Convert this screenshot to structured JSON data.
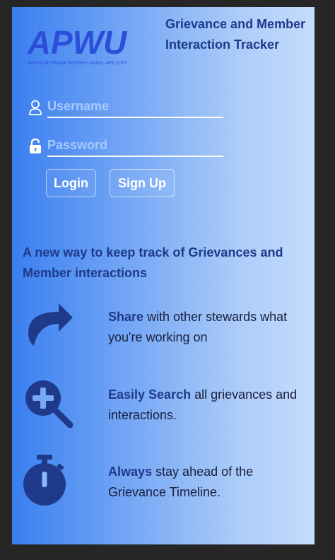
{
  "header": {
    "logo_text": "APWU",
    "logo_subtext": "American Postal Workers Union, AFL-CIO",
    "title": "Grievance and Member Interaction Tracker"
  },
  "login_form": {
    "username_placeholder": "Username",
    "password_placeholder": "Password",
    "login_label": "Login",
    "signup_label": "Sign Up"
  },
  "tagline": "A new way to keep track of Grievances and Member interactions",
  "features": [
    {
      "icon": "share-icon",
      "highlight": "Share",
      "text": " with other stewards what you're working on"
    },
    {
      "icon": "search-plus-icon",
      "highlight": "Easily Search",
      "text": " all grievances and interactions."
    },
    {
      "icon": "stopwatch-icon",
      "highlight": "Always",
      "text": " stay ahead of the Grievance Timeline."
    }
  ],
  "colors": {
    "page_bg": "#262626",
    "gradient_start": "#3a7ff0",
    "gradient_end": "#c4dcfc",
    "heading": "#1f3a8a",
    "icon": "#1f3a8a",
    "placeholder": "#a9c9fb"
  }
}
